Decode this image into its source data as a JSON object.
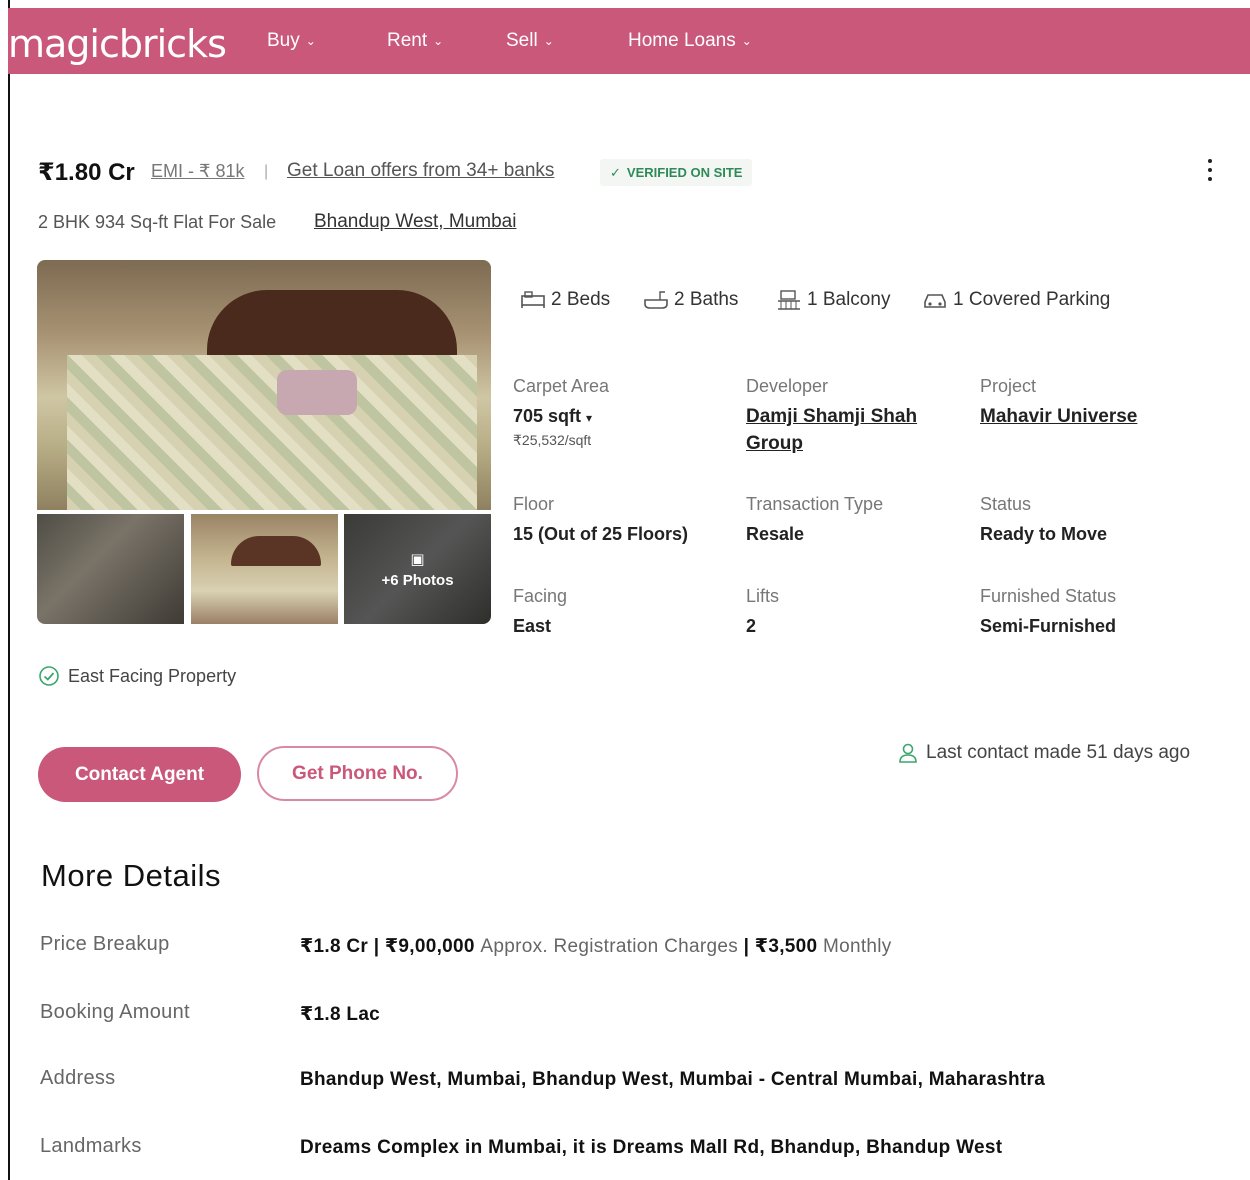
{
  "header": {
    "logo": "magicbricks",
    "nav": [
      {
        "label": "Buy"
      },
      {
        "label": "Rent"
      },
      {
        "label": "Sell"
      },
      {
        "label": "Home Loans"
      }
    ]
  },
  "listing": {
    "price": "₹1.80 Cr",
    "emi": "EMI - ₹ 81k",
    "separator": "|",
    "loan_link": "Get Loan offers from 34+ banks",
    "verified_badge": "VERIFIED ON SITE",
    "subtitle": "2 BHK 934 Sq-ft Flat For Sale",
    "location": "Bhandup West, Mumbai",
    "photos_more": "+6 Photos",
    "amenities": {
      "beds": "2 Beds",
      "baths": "2 Baths",
      "balcony": "1 Balcony",
      "parking": "1 Covered Parking"
    },
    "details": {
      "carpet_area_label": "Carpet Area",
      "carpet_area_value": "705 sqft",
      "carpet_area_rate": "₹25,532/sqft",
      "developer_label": "Developer",
      "developer_line1": "Damji Shamji Shah",
      "developer_line2": "Group",
      "project_label": "Project",
      "project_value": "Mahavir Universe",
      "floor_label": "Floor",
      "floor_value": "15 (Out of 25 Floors)",
      "transaction_label": "Transaction Type",
      "transaction_value": "Resale",
      "status_label": "Status",
      "status_value": "Ready to Move",
      "facing_label": "Facing",
      "facing_value": "East",
      "lifts_label": "Lifts",
      "lifts_value": "2",
      "furnished_label": "Furnished Status",
      "furnished_value": "Semi-Furnished"
    },
    "highlight": "East Facing Property",
    "contact_button": "Contact Agent",
    "phone_button": "Get Phone No.",
    "last_contact": "Last contact made 51 days ago"
  },
  "more_details": {
    "title": "More Details",
    "price_breakup_label": "Price Breakup",
    "price_breakup_price": "₹1.8 Cr | ₹9,00,000",
    "price_breakup_reg": "Approx. Registration Charges",
    "price_breakup_maint": "| ₹3,500",
    "price_breakup_monthly": "Monthly",
    "booking_label": "Booking Amount",
    "booking_value": "₹1.8 Lac",
    "address_label": "Address",
    "address_value": "Bhandup West, Mumbai, Bhandup West, Mumbai - Central Mumbai, Maharashtra",
    "landmarks_label": "Landmarks",
    "landmarks_value": "Dreams Complex in Mumbai, it is Dreams Mall Rd, Bhandup, Bhandup West"
  },
  "colors": {
    "brand": "#c9587b",
    "verified": "#2e8b57"
  }
}
